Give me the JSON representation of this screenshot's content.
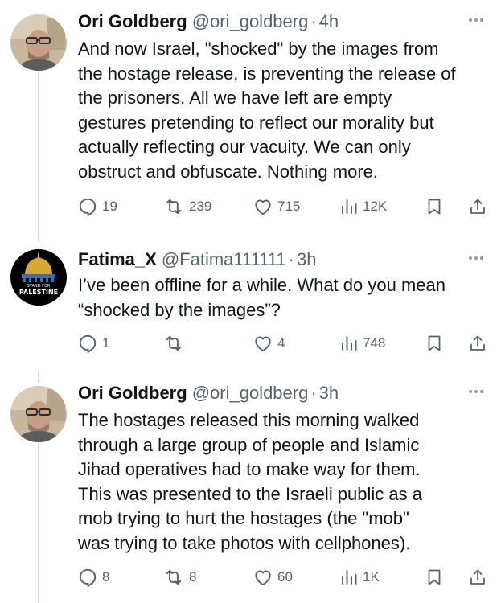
{
  "tweets": [
    {
      "name": "Ori Goldberg",
      "handle": "@ori_goldberg",
      "separator": "·",
      "time": "4h",
      "text": "And now Israel, \"shocked\" by the images from\nthe hostage release, is preventing the release of\nthe prisoners. All we have left are empty\ngestures pretending to reflect our morality but\nactually reflecting our vacuity. We can only\nobstruct and obfuscate. Nothing more.",
      "replies": "19",
      "retweets": "239",
      "likes": "715",
      "views": "12K"
    },
    {
      "name": "Fatima_X",
      "handle": "@Fatima111111",
      "separator": "·",
      "time": "3h",
      "text": "I’ve been offline for a while. What do you mean\n“shocked by the images”?",
      "avatar_text": {
        "line1": "STAND FOR",
        "line2": "PALESTINE"
      },
      "replies": "1",
      "retweets": "",
      "likes": "4",
      "views": "748"
    },
    {
      "name": "Ori Goldberg",
      "handle": "@ori_goldberg",
      "separator": "·",
      "time": "3h",
      "text": "The hostages released this morning walked\nthrough a large group of people and Islamic\nJihad operatives had to make way for them.\nThis was presented to the Israeli public as a\nmob trying to hurt the hostages (the \"mob\"\nwas trying to take photos with cellphones).",
      "replies": "8",
      "retweets": "8",
      "likes": "60",
      "views": "1K"
    }
  ],
  "icons": {
    "more": "more-icon",
    "reply": "reply-icon",
    "retweet": "retweet-icon",
    "like": "like-icon",
    "views": "views-icon",
    "bookmark": "bookmark-icon",
    "share": "share-icon"
  },
  "colors": {
    "text": "#0f1419",
    "secondary": "#536471",
    "thread_line": "#cfd9de"
  }
}
